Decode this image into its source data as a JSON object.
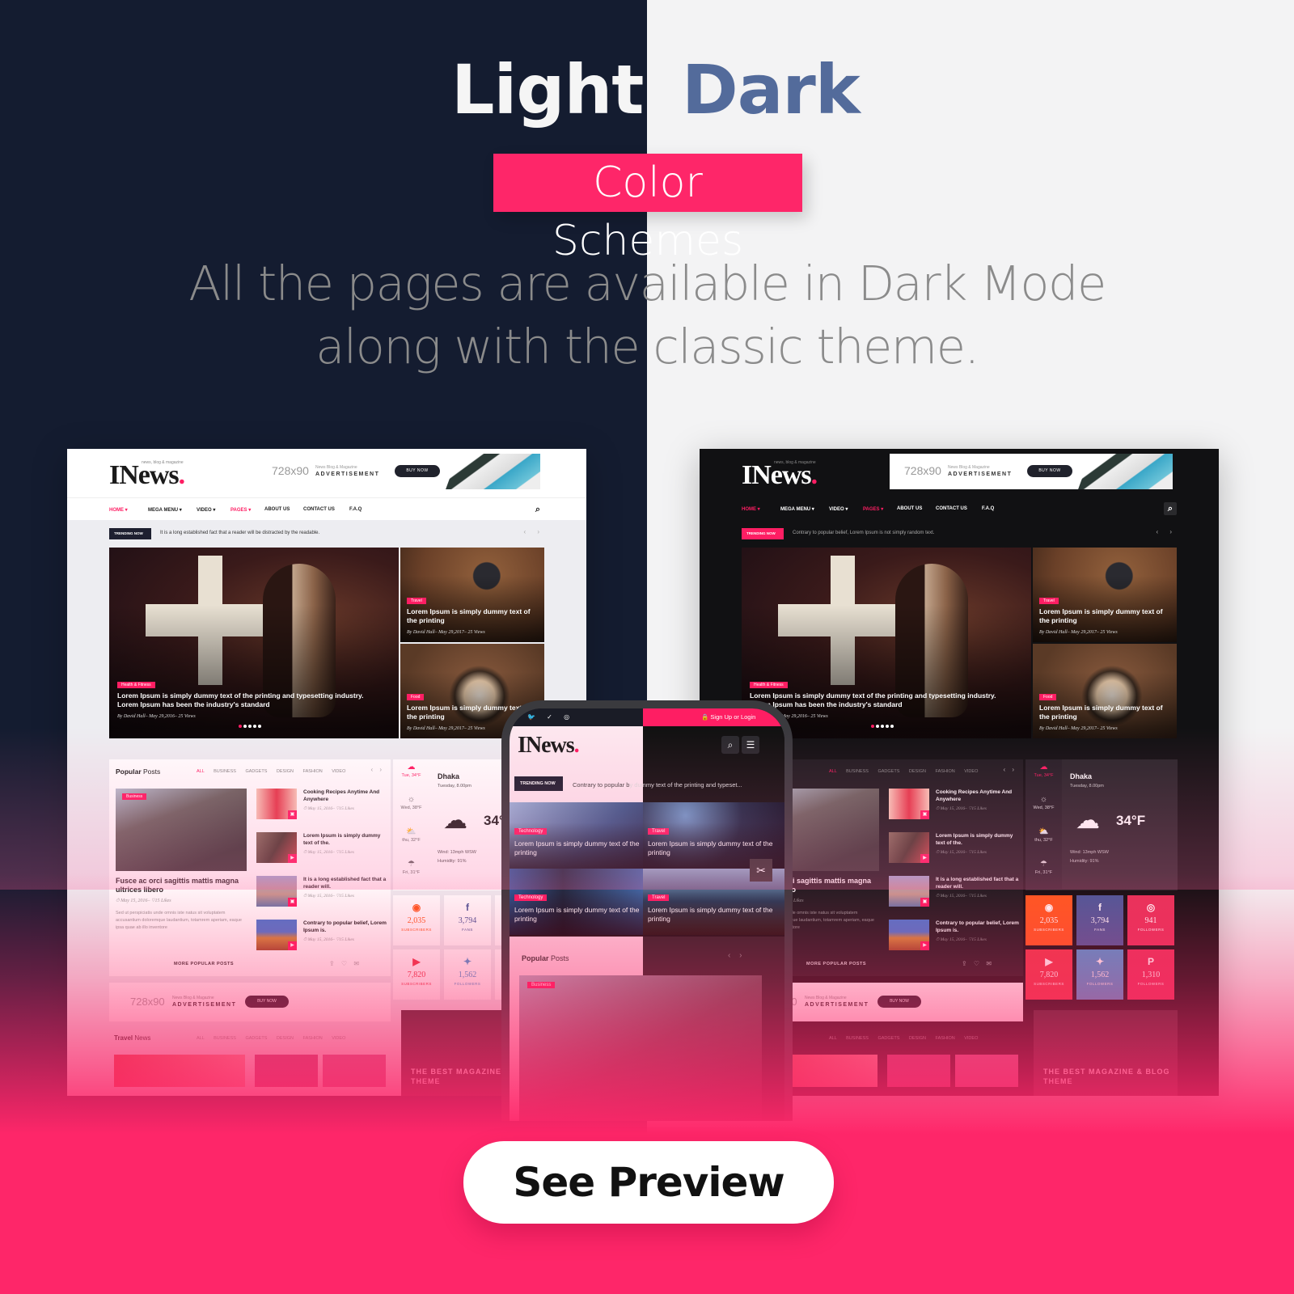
{
  "hero": {
    "title_light": "Light",
    "title_dark": "Dark",
    "badge": "Color Schemes",
    "subtitle_line1": "All the pages are available in Dark Mode",
    "subtitle_line2": "along with the classic theme."
  },
  "colors": {
    "accent": "#fe2669",
    "navy": "#141c30",
    "dark_title": "#536b9b",
    "light_bg": "#f3f3f4"
  },
  "site": {
    "logo": "INews",
    "logo_dot": ".",
    "logo_tagline": "news, blog & magazine",
    "ad": {
      "size": "728x90",
      "small": "News Blog & Magazine",
      "label": "ADVERTISEMENT",
      "button": "BUY NOW"
    },
    "nav": [
      "HOME ▾",
      "MEGA MENU ▾",
      "VIDEO ▾",
      "PAGES ▾",
      "ABOUT US",
      "CONTACT US",
      "F.A.Q"
    ],
    "search_icon": "⌕",
    "trending_label": "TRENDING NOW",
    "trending_light": "It is a long established fact that a reader will be distracted by the readable.",
    "trending_dark": "Contrary to popular belief, Lorem Ipsum is not simply random text.",
    "arrows": "‹ ›",
    "featured": {
      "main": {
        "category": "Health & Fitness",
        "title": "Lorem Ipsum is simply dummy text of the printing and typesetting industry. Lorem Ipsum has been the industry's standard",
        "meta": "By David Hall– May 29,2016– 25 Views"
      },
      "side": [
        {
          "category": "Travel",
          "title": "Lorem Ipsum is simply dummy text of the printing",
          "meta": "By David Hall– May 29,2017– 25 Views"
        },
        {
          "category": "Food",
          "title": "Lorem Ipsum is simply dummy text of the printing",
          "meta": "By David Hall– May 29,2017– 25 Views"
        }
      ]
    },
    "popular": {
      "title_bold": "Popular",
      "title_rest": " Posts",
      "tabs": [
        "ALL",
        "BUSINESS",
        "GADGETS",
        "DESIGN",
        "FASHION",
        "VIDEO"
      ],
      "nav": "‹ ›",
      "big": {
        "category": "Business",
        "title": "Fusce ac orci sagittis mattis magna ultrices libero",
        "meta": "⏱ May 15, 2016– ♡15 Likes",
        "desc": "Sed ut perspiciatis unde omnis iste natus sit voluptatem accusantium doloremque laudantium, totamrem aperiam, eaque ipsa quae ab illo inventore"
      },
      "list": [
        {
          "title": "Cooking Recipes Anytime And Anywhere",
          "meta": "⏱ May 15, 2016– ♡15 Likes",
          "icon": "▣"
        },
        {
          "title": "Lorem Ipsum is simply dummy text of the.",
          "meta": "⏱ May 15, 2016– ♡15 Likes",
          "icon": "▶"
        },
        {
          "title": "It is a long established fact that a reader will.",
          "meta": "⏱ May 15, 2016– ♡15 Likes",
          "icon": "▣"
        },
        {
          "title": "Contrary to popular belief, Lorem Ipsum is.",
          "meta": "⏱ May 15, 2016– ♡15 Likes",
          "icon": "▶"
        }
      ],
      "more": "MORE POPULAR POSTS",
      "share": "⇪ ♡ ✉"
    },
    "weather": {
      "days": [
        {
          "label": "Tue, 34°F",
          "icon": "☁"
        },
        {
          "label": "Wed, 38°F",
          "icon": "☼"
        },
        {
          "label": "thu, 32°F",
          "icon": "⛅"
        },
        {
          "label": "Fri, 31°F",
          "icon": "☂"
        }
      ],
      "city": "Dhaka",
      "date": "Tuesday, 8.00pm",
      "icon": "☁",
      "temp": "34°F",
      "wind": "Wind: 13mph WSW",
      "humidity": "Humidity: 91%"
    },
    "social": [
      {
        "icon": "◉",
        "count": "2,035",
        "label": "SUBSCRIBERS",
        "color": "#ff5a1f"
      },
      {
        "icon": "f",
        "count": "3,794",
        "label": "FANS",
        "color": "#4a5a9a"
      },
      {
        "icon": "◎",
        "count": "941",
        "label": "FOLLOWERS",
        "color": "#e8335a"
      },
      {
        "icon": "▶",
        "count": "7,820",
        "label": "SUBSCRIBERS",
        "color": "#ec3a4a"
      },
      {
        "icon": "✦",
        "count": "1,562",
        "label": "FOLLOWERS",
        "color": "#4a9ad4"
      },
      {
        "icon": "P",
        "count": "1,310",
        "label": "FOLLOWERS",
        "color": "#e8335a"
      }
    ],
    "travel": {
      "title_bold": "Travel",
      "title_rest": " News",
      "tabs": [
        "ALL",
        "BUSINESS",
        "GADGETS",
        "DESIGN",
        "FASHION",
        "VIDEO"
      ]
    },
    "promo": "THE BEST MAGAZINE & BLOG THEME"
  },
  "phone": {
    "social_icons": "🐦 ✓ ◎",
    "signup": "🔒 Sign Up or Login",
    "logo": "INews",
    "logo_dot": ".",
    "search_icon": "⌕",
    "menu_icon": "☰",
    "trending_label": "TRENDING NOW",
    "trending_text_a": "Contrary to popular b",
    "trending_text_b": "y dummy text of the printing and typeset...",
    "tiles": [
      {
        "category": "Technology",
        "title": "Lorem Ipsum is simply dummy text of the printing"
      },
      {
        "category": "Travel",
        "title": "Lorem Ipsum is simply dummy text of the printing"
      },
      {
        "category": "Technology",
        "title": "Lorem Ipsum is simply dummy text of the printing"
      },
      {
        "category": "Travel",
        "title": "Lorem Ipsum is simply dummy text of the printing"
      }
    ],
    "tool_icon": "✂",
    "popular_bold": "Popular",
    "popular_rest": " Posts",
    "popular_nav": "‹ ›",
    "business_cat": "Business"
  },
  "cta": {
    "label": "See Preview"
  }
}
